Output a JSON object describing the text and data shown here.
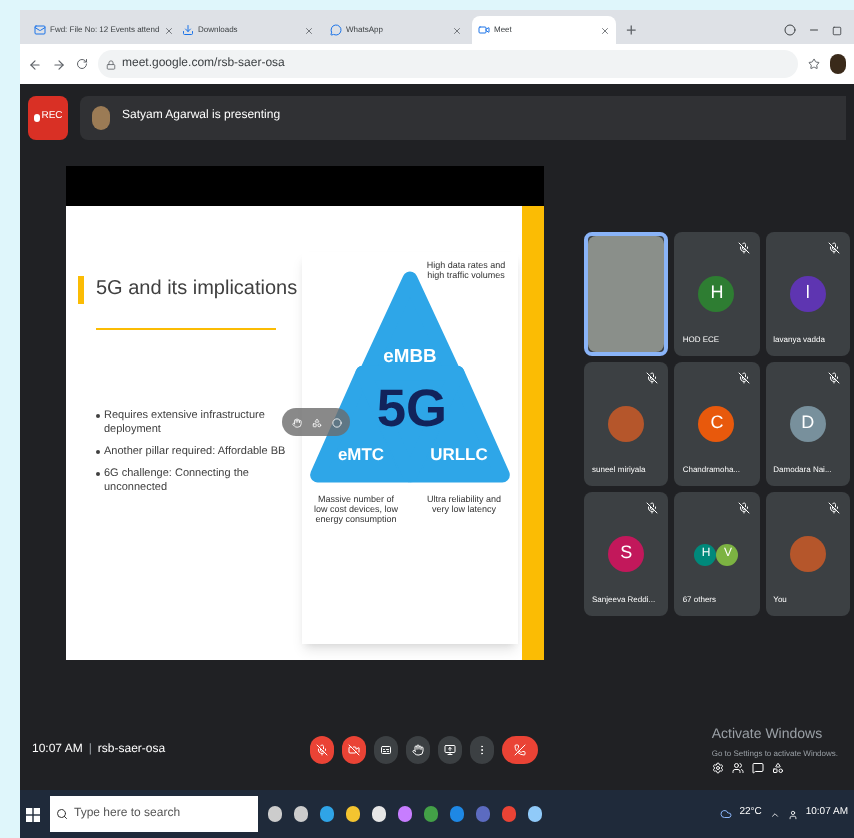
{
  "browser": {
    "tabs": [
      {
        "label": "Fwd: File No: 12 Events attend",
        "selected": false,
        "kind": "mail"
      },
      {
        "label": "Downloads",
        "selected": false,
        "kind": "download"
      },
      {
        "label": "WhatsApp",
        "selected": false,
        "kind": "whatsapp"
      },
      {
        "label": "Meet",
        "selected": true,
        "kind": "meet"
      }
    ],
    "new_tab": "+",
    "url": "meet.google.com/rsb-saer-osa"
  },
  "meet": {
    "rec": "REC",
    "presenting": "Satyam Agarwal is presenting",
    "slide": {
      "title": "5G and its implications",
      "bullets": [
        "Requires extensive infrastructure deployment",
        "Another pillar required: Affordable BB",
        "6G challenge: Connecting the unconnected"
      ],
      "diagram": {
        "center": "5G",
        "top": "eMBB",
        "left": "eMTC",
        "right": "URLLC",
        "top_caption": "High data rates and high traffic volumes",
        "left_caption": "Massive number of low cost devices, low energy consumption",
        "right_caption": "Ultra reliability and very low latency"
      }
    },
    "participants": [
      {
        "kind": "video",
        "speaking": true
      },
      {
        "kind": "initial",
        "name": "HOD ECE",
        "initial": "H",
        "color": "#2e7d32",
        "speaking": false
      },
      {
        "kind": "initial",
        "name": "lavanya vadda",
        "initial": "l",
        "color": "#5e35b1",
        "speaking": false
      },
      {
        "kind": "photo",
        "name": "suneel miriyala",
        "speaking": false
      },
      {
        "kind": "initial",
        "name": "Chandramoha...",
        "initial": "C",
        "color": "#e8590c",
        "speaking": false
      },
      {
        "kind": "initial",
        "name": "Damodara Nai...",
        "initial": "D",
        "color": "#78909c",
        "speaking": false
      },
      {
        "kind": "initial",
        "name": "Sanjeeva Reddi...",
        "initial": "S",
        "color": "#c2185b",
        "speaking": false
      },
      {
        "kind": "group",
        "name": "67 others",
        "initials": [
          {
            "initial": "H",
            "color": "#00897b"
          },
          {
            "initial": "V",
            "color": "#7cb342"
          }
        ],
        "speaking": false
      },
      {
        "kind": "photo",
        "name": "You",
        "speaking": false
      }
    ],
    "time": "10:07 AM",
    "separator": "|",
    "meeting_code": "rsb-saer-osa",
    "controls": [
      {
        "kind": "mic",
        "danger": true
      },
      {
        "kind": "camera",
        "danger": true
      },
      {
        "kind": "captions",
        "danger": false
      },
      {
        "kind": "hand",
        "danger": false
      },
      {
        "kind": "present",
        "danger": false
      },
      {
        "kind": "more",
        "danger": false
      },
      {
        "kind": "hangup",
        "danger": true
      }
    ],
    "activation": {
      "title": "Activate Windows",
      "subtitle": "Go to Settings to activate Windows."
    }
  },
  "taskbar": {
    "search_placeholder": "Type here to search",
    "temperature": "22°C",
    "clock": "10:07 AM"
  }
}
